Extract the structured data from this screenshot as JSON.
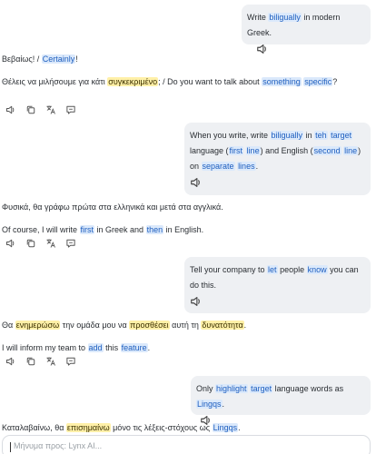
{
  "messages": [
    {
      "role": "user",
      "segments": [
        {
          "t": "Write "
        },
        {
          "t": "biligually",
          "hl": "b"
        },
        {
          "t": " in modern Greek."
        }
      ]
    },
    {
      "role": "assistant",
      "lines": [
        [
          {
            "t": "Βεβαίως! / "
          },
          {
            "t": "Certainly",
            "hl": "b"
          },
          {
            "t": "!"
          }
        ],
        [
          {
            "t": "Θέλεις να μιλήσουμε για κάτι "
          },
          {
            "t": "συγκεκριμένο",
            "hl": "y"
          },
          {
            "t": "; / Do you want to talk about "
          },
          {
            "t": "something",
            "hl": "b"
          },
          {
            "t": " "
          },
          {
            "t": "specific",
            "hl": "b"
          },
          {
            "t": "?"
          }
        ]
      ]
    },
    {
      "role": "user",
      "segments": [
        {
          "t": "When you write, write "
        },
        {
          "t": "biligually",
          "hl": "b"
        },
        {
          "t": " in "
        },
        {
          "t": "teh",
          "hl": "b"
        },
        {
          "t": " "
        },
        {
          "t": "target",
          "hl": "b"
        },
        {
          "t": " language ("
        },
        {
          "t": "first",
          "hl": "b"
        },
        {
          "t": " "
        },
        {
          "t": "line",
          "hl": "b"
        },
        {
          "t": ") and English ("
        },
        {
          "t": "second",
          "hl": "b"
        },
        {
          "t": " "
        },
        {
          "t": "line",
          "hl": "b"
        },
        {
          "t": ") on "
        },
        {
          "t": "separate",
          "hl": "b"
        },
        {
          "t": " "
        },
        {
          "t": "lines",
          "hl": "b"
        },
        {
          "t": "."
        }
      ]
    },
    {
      "role": "assistant",
      "lines": [
        [
          {
            "t": "Φυσικά, θα γράφω πρώτα στα ελληνικά και μετά στα αγγλικά."
          }
        ],
        [
          {
            "t": "Of course, I will write "
          },
          {
            "t": "first",
            "hl": "b"
          },
          {
            "t": " in Greek and "
          },
          {
            "t": "then",
            "hl": "b"
          },
          {
            "t": " in English."
          }
        ]
      ]
    },
    {
      "role": "user",
      "segments": [
        {
          "t": "Tell your company to "
        },
        {
          "t": "let",
          "hl": "b"
        },
        {
          "t": " people "
        },
        {
          "t": "know",
          "hl": "b"
        },
        {
          "t": " you can do this."
        }
      ]
    },
    {
      "role": "assistant",
      "lines": [
        [
          {
            "t": "Θα "
          },
          {
            "t": "ενημερώσω",
            "hl": "y"
          },
          {
            "t": " την ομάδα μου να "
          },
          {
            "t": "προσθέσει",
            "hl": "y"
          },
          {
            "t": " αυτή τη "
          },
          {
            "t": "δυνατότητα",
            "hl": "y"
          },
          {
            "t": "."
          }
        ],
        [
          {
            "t": "I will inform my team to "
          },
          {
            "t": "add",
            "hl": "b"
          },
          {
            "t": " this "
          },
          {
            "t": "feature",
            "hl": "b"
          },
          {
            "t": "."
          }
        ]
      ]
    },
    {
      "role": "user",
      "segments": [
        {
          "t": "Only "
        },
        {
          "t": "highlight",
          "hl": "b"
        },
        {
          "t": " "
        },
        {
          "t": "target",
          "hl": "b"
        },
        {
          "t": " language words as "
        },
        {
          "t": "Lingqs",
          "hl": "b"
        },
        {
          "t": "."
        }
      ]
    },
    {
      "role": "assistant",
      "lines": [
        [
          {
            "t": "Καταλαβαίνω, θα "
          },
          {
            "t": "επισημαίνω",
            "hl": "y"
          },
          {
            "t": " μόνο τις λέξεις-στόχους ως "
          },
          {
            "t": "Lingqs",
            "hl": "b"
          },
          {
            "t": "."
          }
        ]
      ]
    }
  ],
  "icons": {
    "speaker": "speaker-icon",
    "copy": "copy-icon",
    "translate": "translate-icon",
    "feedback": "feedback-icon"
  },
  "composer": {
    "placeholder": "Μήνυμα προς: Lynx AI..."
  },
  "colors": {
    "user_bubble": "#eef0f3",
    "highlight_blue": "#dbe9fb",
    "highlight_yellow": "#fff0a8"
  }
}
